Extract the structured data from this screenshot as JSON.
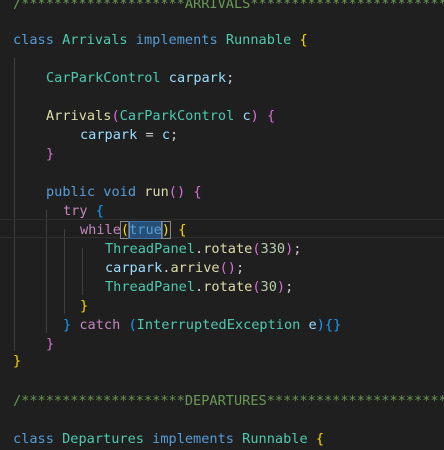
{
  "editor": {
    "lines": {
      "l1": {
        "comment": "/********************ARRIVALS*************************"
      },
      "l2": {
        "kw": "class",
        "name": "Arrivals",
        "impl": "implements",
        "iface": "Runnable",
        "brace": "{"
      },
      "l3": {
        "type": "CarParkControl",
        "field": "carpark",
        "semi": ";"
      },
      "l4": {
        "name": "Arrivals",
        "open": "(",
        "type": "CarParkControl",
        "param": "c",
        "close": ")",
        "brace": "{"
      },
      "l5": {
        "field": "carpark",
        "eq": " = ",
        "val": "c",
        "semi": ";"
      },
      "l6": {
        "brace": "}"
      },
      "l7": {
        "kw1": "public",
        "kw2": "void",
        "name": "run",
        "open": "(",
        "close": ")",
        "brace": "{"
      },
      "l8": {
        "kw": "try",
        "brace": "{"
      },
      "l9": {
        "kw": "while",
        "open": "(",
        "val": "true",
        "close": ")",
        "brace": "{"
      },
      "l10": {
        "cls": "ThreadPanel",
        "dot": ".",
        "fn": "rotate",
        "open": "(",
        "num": "330",
        "close": ")",
        "semi": ";"
      },
      "l11": {
        "obj": "carpark",
        "dot": ".",
        "fn": "arrive",
        "open": "(",
        "close": ")",
        "semi": ";"
      },
      "l12": {
        "cls": "ThreadPanel",
        "dot": ".",
        "fn": "rotate",
        "open": "(",
        "num": "30",
        "close": ")",
        "semi": ";"
      },
      "l13": {
        "brace": "}"
      },
      "l14": {
        "brace1": "}",
        "kw": "catch",
        "open": "(",
        "type": "InterruptedException",
        "param": "e",
        "close": ")",
        "braces": "{}"
      },
      "l15": {
        "brace": "}"
      },
      "l16": {
        "brace": "}"
      },
      "l17": {
        "comment": "/********************DEPARTURES**********************"
      },
      "l18": {
        "kw": "class",
        "name": "Departures",
        "impl": "implements",
        "iface": "Runnable",
        "brace": "{"
      }
    }
  },
  "colors": {
    "background": "#1f1f1f",
    "keyword": "#569cd6",
    "control": "#c586c0",
    "class": "#4ec9b0",
    "function": "#dcdcaa",
    "variable": "#9cdcfe",
    "number": "#b5cea8",
    "comment": "#6a9955",
    "bracket1": "#ffd700",
    "bracket2": "#da70d6",
    "bracket3": "#179fff",
    "selection": "#264f78"
  }
}
